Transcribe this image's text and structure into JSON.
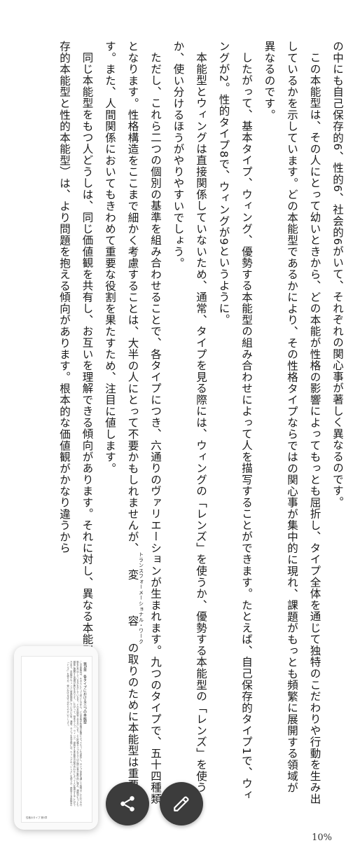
{
  "paragraphs": [
    {
      "indent": false,
      "text": "の中にも自己保存的6、性的6、社会的6がいて、それぞれの関心事が著しく異なるのです。"
    },
    {
      "indent": true,
      "text": "この本能型は、その人にとって幼いときから、どの本能が性格の影響によってもっとも屈折し、タイプ全体を通じて独特のこだわりや行動を生み出しているかを示しています。どの本能型であるかにより、その性格タイプならではの関心事が集中的に現れ、課題がもっとも頻繁に展開する領域が異なるのです。"
    },
    {
      "indent": true,
      "text": "したがって、基本タイプ、ウィング、優勢する本能型の組み合わせによって人を描写することができます。たとえば、自己保存的タイプ1で、ウィングが2。性的タイプ8で、ウィングが9というように。"
    },
    {
      "indent": true,
      "text": "本能型とウィングは直接関係していないため、通常、タイプを見る際には、ウィングの「レンズ」を使うか、優勢する本能型の「レンズ」を使うか、使い分けるほうがやりやすいでしょう。"
    },
    {
      "indent": true,
      "text": "ただし、これら二つの個別の基準を組み合わせることで、各タイプにつき、六通りのヴァリエーションが生まれます。九つのタイプで、五十四種類となります。性格構造をここまで細かく考慮することは、大半の人にとって不要かもしれませんが、変容の取りのために本能型は重要です。また、人間関係においてもきわめて重要な役割を果たすため、注目に値します。"
    },
    {
      "indent": true,
      "text": "同じ本能型をもつ人どうしは、同じ価値観を共有し、お互いを理解できる傾向があります。それに対し、異なる本能型の人どうし（たとえば自己保存的本能型と性的本能型）は、より問題を抱える傾向があります。根本的な価値観がかなり違うから"
    }
  ],
  "ruby_text": "トランスフォーメーショナル・ワーク",
  "progress": "10%",
  "thumbnail": {
    "chapter": "第5章",
    "heading": "各タイプにおける三つの本能型",
    "body": "この本能型は、その人にとって幼いときから、どの本能が性格の影響によってもっとも屈折し、タイプ全体を通じて独特のこだわりや行動を生み出しているかを示しています。どの本能型であるかにより、その性格タイプならではの関心事が集中的に現れ、課題がもっとも頻繁に展開する領域が異なるのです。したがって、基本タイプ、ウィング、優勢する本能型の組み合わせによって人を描写することができます。本能型とウィングは直接関係していないため、通常、タイプを見る際には、ウィングの「レンズ」を使うか、優勢する本能型の「レンズ」を使うか、使い分けるほうがやりやすいでしょう。",
    "footer": "性格のタイプ 第5章"
  },
  "buttons": {
    "share_icon": "share-icon",
    "edit_icon": "pencil-icon"
  },
  "colors": {
    "fab": "#3c3c3c",
    "text": "#1a1a1a",
    "background": "#ffffff"
  }
}
